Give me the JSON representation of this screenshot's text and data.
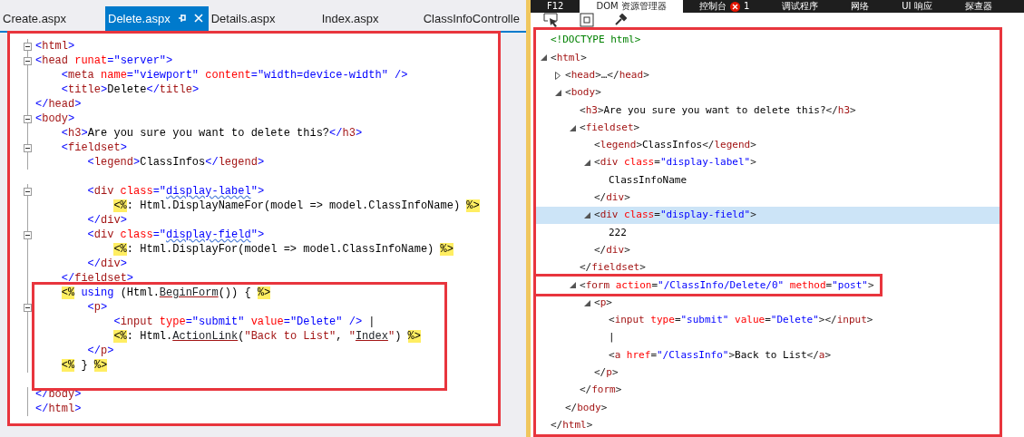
{
  "editor": {
    "tabs": [
      {
        "label": "Create.aspx",
        "selected": false
      },
      {
        "label": "Delete.aspx",
        "selected": true
      },
      {
        "label": "Details.aspx",
        "selected": false
      },
      {
        "label": "Index.aspx",
        "selected": false
      },
      {
        "label": "ClassInfoControlle",
        "selected": false
      }
    ],
    "boxed": true,
    "blocks": [
      {
        "boxed": false,
        "lines": [
          {
            "fold": true,
            "segs": [
              {
                "kind": "bracket",
                "text": "<"
              },
              {
                "kind": "tag",
                "text": "html"
              },
              {
                "kind": "bracket",
                "text": ">"
              }
            ]
          },
          {
            "fold": true,
            "segs": [
              {
                "kind": "bracket",
                "text": "<"
              },
              {
                "kind": "tag",
                "text": "head"
              },
              {
                "kind": "attr",
                "text": " runat"
              },
              {
                "kind": "bracket",
                "text": "="
              },
              {
                "kind": "value",
                "text": "\"server\""
              },
              {
                "kind": "bracket",
                "text": ">"
              }
            ]
          },
          {
            "fold": false,
            "segs": [
              {
                "kind": "bracket",
                "text": "    <"
              },
              {
                "kind": "tag",
                "text": "meta"
              },
              {
                "kind": "attr",
                "text": " name"
              },
              {
                "kind": "bracket",
                "text": "="
              },
              {
                "kind": "value",
                "text": "\"viewport\""
              },
              {
                "kind": "attr",
                "text": " content"
              },
              {
                "kind": "bracket",
                "text": "="
              },
              {
                "kind": "value",
                "text": "\"width=device-width\""
              },
              {
                "kind": "bracket",
                "text": " />"
              }
            ]
          },
          {
            "fold": false,
            "segs": [
              {
                "kind": "bracket",
                "text": "    <"
              },
              {
                "kind": "tag",
                "text": "title"
              },
              {
                "kind": "bracket",
                "text": ">"
              },
              {
                "kind": "text",
                "text": "Delete"
              },
              {
                "kind": "bracket",
                "text": "</"
              },
              {
                "kind": "tag",
                "text": "title"
              },
              {
                "kind": "bracket",
                "text": ">"
              }
            ]
          },
          {
            "fold": false,
            "segs": [
              {
                "kind": "bracket",
                "text": "</"
              },
              {
                "kind": "tag",
                "text": "head"
              },
              {
                "kind": "bracket",
                "text": ">"
              }
            ]
          },
          {
            "fold": true,
            "segs": [
              {
                "kind": "bracket",
                "text": "<"
              },
              {
                "kind": "tag",
                "text": "body"
              },
              {
                "kind": "bracket",
                "text": ">"
              }
            ]
          },
          {
            "fold": false,
            "segs": [
              {
                "kind": "bracket",
                "text": "    <"
              },
              {
                "kind": "tag",
                "text": "h3"
              },
              {
                "kind": "bracket",
                "text": ">"
              },
              {
                "kind": "text",
                "text": "Are you sure you want to delete this?"
              },
              {
                "kind": "bracket",
                "text": "</"
              },
              {
                "kind": "tag",
                "text": "h3"
              },
              {
                "kind": "bracket",
                "text": ">"
              }
            ]
          },
          {
            "fold": true,
            "segs": [
              {
                "kind": "bracket",
                "text": "    <"
              },
              {
                "kind": "tag",
                "text": "fieldset"
              },
              {
                "kind": "bracket",
                "text": ">"
              }
            ]
          },
          {
            "fold": false,
            "segs": [
              {
                "kind": "bracket",
                "text": "        <"
              },
              {
                "kind": "tag",
                "text": "legend"
              },
              {
                "kind": "bracket",
                "text": ">"
              },
              {
                "kind": "text",
                "text": "ClassInfos"
              },
              {
                "kind": "bracket",
                "text": "</"
              },
              {
                "kind": "tag",
                "text": "legend"
              },
              {
                "kind": "bracket",
                "text": ">"
              }
            ]
          }
        ]
      },
      {
        "boxed": false,
        "lines": [
          {
            "fold": true,
            "segs": [
              {
                "kind": "bracket",
                "text": "        <"
              },
              {
                "kind": "tag",
                "text": "div"
              },
              {
                "kind": "attr",
                "text": " class"
              },
              {
                "kind": "bracket",
                "text": "="
              },
              {
                "kind": "value",
                "text": "\""
              },
              {
                "kind": "squiggle",
                "text": "display-label"
              },
              {
                "kind": "value",
                "text": "\""
              },
              {
                "kind": "bracket",
                "text": ">"
              }
            ]
          },
          {
            "fold": false,
            "segs": [
              {
                "kind": "delim",
                "text": "            <%"
              },
              {
                "kind": "text",
                "text": ": Html.DisplayNameFor(model => model.ClassInfoName) "
              },
              {
                "kind": "delim",
                "text": "%>"
              }
            ]
          },
          {
            "fold": false,
            "segs": [
              {
                "kind": "bracket",
                "text": "        </"
              },
              {
                "kind": "tag",
                "text": "div"
              },
              {
                "kind": "bracket",
                "text": ">"
              }
            ]
          },
          {
            "fold": true,
            "segs": [
              {
                "kind": "bracket",
                "text": "        <"
              },
              {
                "kind": "tag",
                "text": "div"
              },
              {
                "kind": "attr",
                "text": " class"
              },
              {
                "kind": "bracket",
                "text": "="
              },
              {
                "kind": "value",
                "text": "\""
              },
              {
                "kind": "squiggle",
                "text": "display-field"
              },
              {
                "kind": "value",
                "text": "\""
              },
              {
                "kind": "bracket",
                "text": ">"
              }
            ]
          },
          {
            "fold": false,
            "segs": [
              {
                "kind": "delim",
                "text": "            <%"
              },
              {
                "kind": "text",
                "text": ": Html.DisplayFor(model => model.ClassInfoName) "
              },
              {
                "kind": "delim",
                "text": "%>"
              }
            ]
          },
          {
            "fold": false,
            "segs": [
              {
                "kind": "bracket",
                "text": "        </"
              },
              {
                "kind": "tag",
                "text": "div"
              },
              {
                "kind": "bracket",
                "text": ">"
              }
            ]
          },
          {
            "fold": false,
            "segs": [
              {
                "kind": "bracket",
                "text": "    </"
              },
              {
                "kind": "tag",
                "text": "fieldset"
              },
              {
                "kind": "bracket",
                "text": ">"
              }
            ]
          }
        ]
      },
      {
        "boxed": true,
        "lines": [
          {
            "fold": false,
            "segs": [
              {
                "kind": "delim",
                "text": "    <%"
              },
              {
                "kind": "keyword",
                "text": " using"
              },
              {
                "kind": "text",
                "text": " (Html."
              },
              {
                "kind": "method",
                "text": "BeginForm"
              },
              {
                "kind": "text",
                "text": "()) { "
              },
              {
                "kind": "delim",
                "text": "%>"
              }
            ]
          },
          {
            "fold": true,
            "segs": [
              {
                "kind": "bracket",
                "text": "        <"
              },
              {
                "kind": "tag",
                "text": "p"
              },
              {
                "kind": "bracket",
                "text": ">"
              }
            ]
          },
          {
            "fold": false,
            "segs": [
              {
                "kind": "bracket",
                "text": "            <"
              },
              {
                "kind": "tag",
                "text": "input"
              },
              {
                "kind": "attr",
                "text": " type"
              },
              {
                "kind": "bracket",
                "text": "="
              },
              {
                "kind": "value",
                "text": "\"submit\""
              },
              {
                "kind": "attr",
                "text": " value"
              },
              {
                "kind": "bracket",
                "text": "="
              },
              {
                "kind": "value",
                "text": "\"Delete\""
              },
              {
                "kind": "bracket",
                "text": " />"
              },
              {
                "kind": "text",
                "text": " |"
              }
            ]
          },
          {
            "fold": false,
            "segs": [
              {
                "kind": "delim",
                "text": "            <%"
              },
              {
                "kind": "text",
                "text": ": Html."
              },
              {
                "kind": "method",
                "text": "ActionLink"
              },
              {
                "kind": "text",
                "text": "("
              },
              {
                "kind": "string",
                "text": "\"Back to List\""
              },
              {
                "kind": "text",
                "text": ", "
              },
              {
                "kind": "string",
                "text": "\""
              },
              {
                "kind": "method",
                "text": "Index"
              },
              {
                "kind": "string",
                "text": "\""
              },
              {
                "kind": "text",
                "text": ") "
              },
              {
                "kind": "delim",
                "text": "%>"
              }
            ]
          },
          {
            "fold": false,
            "segs": [
              {
                "kind": "bracket",
                "text": "        </"
              },
              {
                "kind": "tag",
                "text": "p"
              },
              {
                "kind": "bracket",
                "text": ">"
              }
            ]
          },
          {
            "fold": false,
            "segs": [
              {
                "kind": "delim",
                "text": "    <%"
              },
              {
                "kind": "text",
                "text": " } "
              },
              {
                "kind": "delim",
                "text": "%>"
              }
            ]
          }
        ]
      },
      {
        "boxed": false,
        "lines": [
          {
            "fold": false,
            "segs": [
              {
                "kind": "bracket",
                "text": "</"
              },
              {
                "kind": "tag",
                "text": "body"
              },
              {
                "kind": "bracket",
                "text": ">"
              }
            ]
          },
          {
            "fold": false,
            "segs": [
              {
                "kind": "bracket",
                "text": "</"
              },
              {
                "kind": "tag",
                "text": "html"
              },
              {
                "kind": "bracket",
                "text": ">"
              }
            ]
          }
        ]
      }
    ]
  },
  "devtools": {
    "tabs": [
      {
        "label": "F12",
        "selected": false
      },
      {
        "label": "DOM 资源管理器",
        "selected": true
      },
      {
        "label": "控制台",
        "selected": false,
        "errors": "1"
      },
      {
        "label": "调试程序",
        "selected": false
      },
      {
        "label": "网络",
        "selected": false
      },
      {
        "label": "UI 响应",
        "selected": false
      },
      {
        "label": "探查器",
        "selected": false
      }
    ],
    "boxed": true,
    "tree": [
      {
        "open": [
          {
            "kind": "doctype",
            "text": "<!DOCTYPE html>"
          }
        ],
        "selected": false,
        "boxed": false
      },
      {
        "open": [
          {
            "kind": "bracket",
            "text": "<"
          },
          {
            "kind": "tag",
            "text": "html"
          },
          {
            "kind": "bracket",
            "text": ">"
          }
        ],
        "expanded": true,
        "selected": false,
        "boxed": false,
        "close": [
          {
            "kind": "bracket",
            "text": "</"
          },
          {
            "kind": "tag",
            "text": "html"
          },
          {
            "kind": "bracket",
            "text": ">"
          }
        ],
        "children": [
          {
            "open": [
              {
                "kind": "bracket",
                "text": "<"
              },
              {
                "kind": "tag",
                "text": "head"
              },
              {
                "kind": "bracket",
                "text": ">…</"
              },
              {
                "kind": "tag",
                "text": "head"
              },
              {
                "kind": "bracket",
                "text": ">"
              }
            ],
            "expanded": false,
            "selected": false,
            "boxed": false
          },
          {
            "open": [
              {
                "kind": "bracket",
                "text": "<"
              },
              {
                "kind": "tag",
                "text": "body"
              },
              {
                "kind": "bracket",
                "text": ">"
              }
            ],
            "expanded": true,
            "selected": false,
            "boxed": false,
            "close": [
              {
                "kind": "bracket",
                "text": "</"
              },
              {
                "kind": "tag",
                "text": "body"
              },
              {
                "kind": "bracket",
                "text": ">"
              }
            ],
            "children": [
              {
                "open": [
                  {
                    "kind": "bracket",
                    "text": "<"
                  },
                  {
                    "kind": "tag",
                    "text": "h3"
                  },
                  {
                    "kind": "bracket",
                    "text": ">"
                  },
                  {
                    "kind": "text",
                    "text": "Are you sure you want to delete this?"
                  },
                  {
                    "kind": "bracket",
                    "text": "</"
                  },
                  {
                    "kind": "tag",
                    "text": "h3"
                  },
                  {
                    "kind": "bracket",
                    "text": ">"
                  }
                ],
                "selected": false,
                "boxed": false
              },
              {
                "open": [
                  {
                    "kind": "bracket",
                    "text": "<"
                  },
                  {
                    "kind": "tag",
                    "text": "fieldset"
                  },
                  {
                    "kind": "bracket",
                    "text": ">"
                  }
                ],
                "expanded": true,
                "selected": false,
                "boxed": false,
                "close": [
                  {
                    "kind": "bracket",
                    "text": "</"
                  },
                  {
                    "kind": "tag",
                    "text": "fieldset"
                  },
                  {
                    "kind": "bracket",
                    "text": ">"
                  }
                ],
                "children": [
                  {
                    "open": [
                      {
                        "kind": "bracket",
                        "text": "<"
                      },
                      {
                        "kind": "tag",
                        "text": "legend"
                      },
                      {
                        "kind": "bracket",
                        "text": ">"
                      },
                      {
                        "kind": "text",
                        "text": "ClassInfos"
                      },
                      {
                        "kind": "bracket",
                        "text": "</"
                      },
                      {
                        "kind": "tag",
                        "text": "legend"
                      },
                      {
                        "kind": "bracket",
                        "text": ">"
                      }
                    ],
                    "selected": false,
                    "boxed": false
                  },
                  {
                    "open": [
                      {
                        "kind": "bracket",
                        "text": "<"
                      },
                      {
                        "kind": "tag",
                        "text": "div"
                      },
                      {
                        "kind": "attr",
                        "text": " class"
                      },
                      {
                        "kind": "bracket",
                        "text": "="
                      },
                      {
                        "kind": "value",
                        "text": "\"display-label\""
                      },
                      {
                        "kind": "bracket",
                        "text": ">"
                      }
                    ],
                    "expanded": true,
                    "selected": false,
                    "boxed": false,
                    "close": [
                      {
                        "kind": "bracket",
                        "text": "</"
                      },
                      {
                        "kind": "tag",
                        "text": "div"
                      },
                      {
                        "kind": "bracket",
                        "text": ">"
                      }
                    ],
                    "children": [
                      {
                        "open": [
                          {
                            "kind": "text",
                            "text": "ClassInfoName"
                          }
                        ],
                        "selected": false,
                        "boxed": false
                      }
                    ]
                  },
                  {
                    "open": [
                      {
                        "kind": "bracket",
                        "text": "<"
                      },
                      {
                        "kind": "tag",
                        "text": "div"
                      },
                      {
                        "kind": "attr",
                        "text": " class"
                      },
                      {
                        "kind": "bracket",
                        "text": "="
                      },
                      {
                        "kind": "value",
                        "text": "\"display-field\""
                      },
                      {
                        "kind": "bracket",
                        "text": ">"
                      }
                    ],
                    "expanded": true,
                    "selected": true,
                    "boxed": false,
                    "close": [
                      {
                        "kind": "bracket",
                        "text": "</"
                      },
                      {
                        "kind": "tag",
                        "text": "div"
                      },
                      {
                        "kind": "bracket",
                        "text": ">"
                      }
                    ],
                    "children": [
                      {
                        "open": [
                          {
                            "kind": "text",
                            "text": "222"
                          }
                        ],
                        "selected": false,
                        "boxed": false
                      }
                    ]
                  }
                ]
              },
              {
                "open": [
                  {
                    "kind": "bracket",
                    "text": "<"
                  },
                  {
                    "kind": "tag",
                    "text": "form"
                  },
                  {
                    "kind": "attr",
                    "text": " action"
                  },
                  {
                    "kind": "bracket",
                    "text": "="
                  },
                  {
                    "kind": "value",
                    "text": "\"/ClassInfo/Delete/0\""
                  },
                  {
                    "kind": "attr",
                    "text": " method"
                  },
                  {
                    "kind": "bracket",
                    "text": "="
                  },
                  {
                    "kind": "value",
                    "text": "\"post\""
                  },
                  {
                    "kind": "bracket",
                    "text": ">"
                  }
                ],
                "expanded": true,
                "selected": false,
                "boxed": true,
                "close": [
                  {
                    "kind": "bracket",
                    "text": "</"
                  },
                  {
                    "kind": "tag",
                    "text": "form"
                  },
                  {
                    "kind": "bracket",
                    "text": ">"
                  }
                ],
                "children": [
                  {
                    "open": [
                      {
                        "kind": "bracket",
                        "text": "<"
                      },
                      {
                        "kind": "tag",
                        "text": "p"
                      },
                      {
                        "kind": "bracket",
                        "text": ">"
                      }
                    ],
                    "expanded": true,
                    "selected": false,
                    "boxed": false,
                    "close": [
                      {
                        "kind": "bracket",
                        "text": "</"
                      },
                      {
                        "kind": "tag",
                        "text": "p"
                      },
                      {
                        "kind": "bracket",
                        "text": ">"
                      }
                    ],
                    "children": [
                      {
                        "open": [
                          {
                            "kind": "bracket",
                            "text": "<"
                          },
                          {
                            "kind": "tag",
                            "text": "input"
                          },
                          {
                            "kind": "attr",
                            "text": " type"
                          },
                          {
                            "kind": "bracket",
                            "text": "="
                          },
                          {
                            "kind": "value",
                            "text": "\"submit\""
                          },
                          {
                            "kind": "attr",
                            "text": " value"
                          },
                          {
                            "kind": "bracket",
                            "text": "="
                          },
                          {
                            "kind": "value",
                            "text": "\"Delete\""
                          },
                          {
                            "kind": "bracket",
                            "text": "></"
                          },
                          {
                            "kind": "tag",
                            "text": "input"
                          },
                          {
                            "kind": "bracket",
                            "text": ">"
                          }
                        ],
                        "selected": false,
                        "boxed": false
                      },
                      {
                        "open": [
                          {
                            "kind": "text",
                            "text": "|"
                          }
                        ],
                        "selected": false,
                        "boxed": false
                      },
                      {
                        "open": [
                          {
                            "kind": "bracket",
                            "text": "<"
                          },
                          {
                            "kind": "tag",
                            "text": "a"
                          },
                          {
                            "kind": "attr",
                            "text": " href"
                          },
                          {
                            "kind": "bracket",
                            "text": "="
                          },
                          {
                            "kind": "value",
                            "text": "\"/ClassInfo\""
                          },
                          {
                            "kind": "bracket",
                            "text": ">"
                          },
                          {
                            "kind": "text",
                            "text": "Back to List"
                          },
                          {
                            "kind": "bracket",
                            "text": "</"
                          },
                          {
                            "kind": "tag",
                            "text": "a"
                          },
                          {
                            "kind": "bracket",
                            "text": ">"
                          }
                        ],
                        "selected": false,
                        "boxed": false
                      }
                    ]
                  }
                ]
              }
            ]
          }
        ]
      }
    ]
  }
}
